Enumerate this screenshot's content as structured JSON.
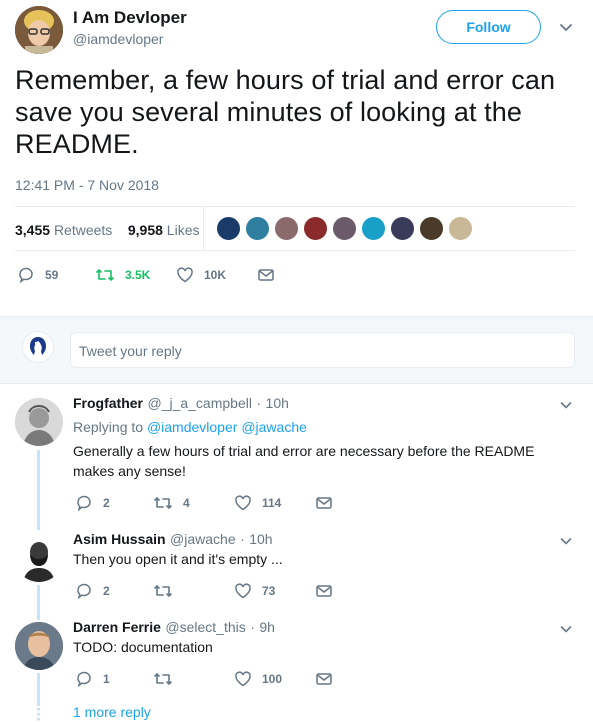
{
  "tweet": {
    "author_name": "I Am Devloper",
    "author_handle": "@iamdevloper",
    "follow_label": "Follow",
    "text": "Remember, a few hours of trial and error can save you several minutes of looking at the README.",
    "timestamp": "12:41 PM - 7 Nov 2018",
    "retweets_count": "3,455",
    "retweets_label": "Retweets",
    "likes_count": "9,958",
    "likes_label": "Likes",
    "actions": {
      "replies": "59",
      "retweets": "3.5K",
      "likes": "10K"
    }
  },
  "reply_box": {
    "placeholder": "Tweet your reply"
  },
  "replies": [
    {
      "name": "Frogfather",
      "handle": "@_j_a_campbell",
      "time": "10h",
      "replying_prefix": "Replying to",
      "replying_to_1": "@iamdevloper",
      "replying_to_2": "@jawache",
      "text_line_1": "Generally a few hours of trial and error are necessary before the README",
      "text_line_2": "makes any sense!",
      "replies": "2",
      "retweets": "4",
      "likes": "114"
    },
    {
      "name": "Asim Hussain",
      "handle": "@jawache",
      "time": "10h",
      "text": "Then you open it and it's empty ...",
      "replies": "2",
      "likes": "73"
    },
    {
      "name": "Darren Ferrie",
      "handle": "@select_this",
      "time": "9h",
      "text": "TODO: documentation",
      "replies": "1",
      "likes": "100"
    }
  ],
  "more_replies_label": "1 more reply",
  "colors": {
    "accent": "#1da1f2",
    "retweet_green": "#17bf63",
    "muted": "#657786",
    "text": "#14171a",
    "thread_line": "#c4e4fb"
  }
}
